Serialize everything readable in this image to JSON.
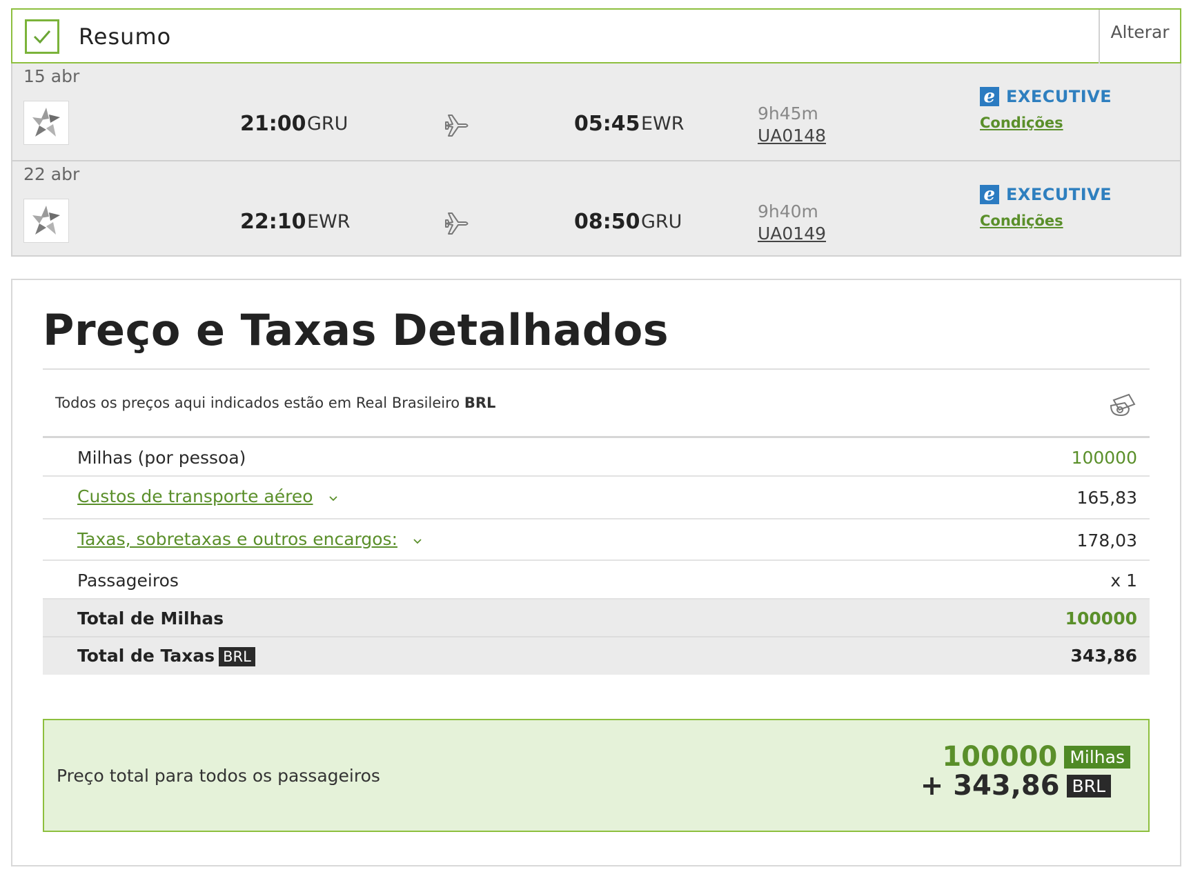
{
  "summary": {
    "title": "Resumo",
    "change_label": "Alterar"
  },
  "flights": [
    {
      "date": "15 abr",
      "depart_time": "21:00",
      "depart_airport": "GRU",
      "arrive_time": "05:45",
      "arrive_airport": "EWR",
      "duration": "9h45m",
      "flight_number": "UA0148",
      "cabin": "EXECUTIVE",
      "conditions_label": "Condições"
    },
    {
      "date": "22 abr",
      "depart_time": "22:10",
      "depart_airport": "EWR",
      "arrive_time": "08:50",
      "arrive_airport": "GRU",
      "duration": "9h40m",
      "flight_number": "UA0149",
      "cabin": "EXECUTIVE",
      "conditions_label": "Condições"
    }
  ],
  "price": {
    "title": "Preço e Taxas Detalhados",
    "currency_note": "Todos os preços aqui indicados estão em Real Brasileiro",
    "currency_code": "BRL",
    "rows": [
      {
        "label": "Milhas (por pessoa)",
        "value": "100000"
      },
      {
        "label": "Custos de transporte aéreo",
        "value": "165,83"
      },
      {
        "label": "Taxas, sobretaxas e outros encargos:",
        "value": "178,03"
      },
      {
        "label": "Passageiros",
        "value": "x 1"
      }
    ],
    "total_miles_label": "Total de Milhas",
    "total_miles_value": "100000",
    "total_taxes_label": "Total de Taxas",
    "total_taxes_currency": "BRL",
    "total_taxes_value": "343,86",
    "grand_total_label": "Preço total para todos os passageiros",
    "grand_total_miles": "100000",
    "grand_total_miles_unit": "Milhas",
    "grand_total_brl": "+ 343,86",
    "grand_total_brl_unit": "BRL"
  },
  "colors": {
    "accent_green": "#5a8f2a",
    "border_green": "#8dbf3e",
    "total_bg": "#e5f2d9",
    "cabin_blue": "#2e7fbf"
  }
}
